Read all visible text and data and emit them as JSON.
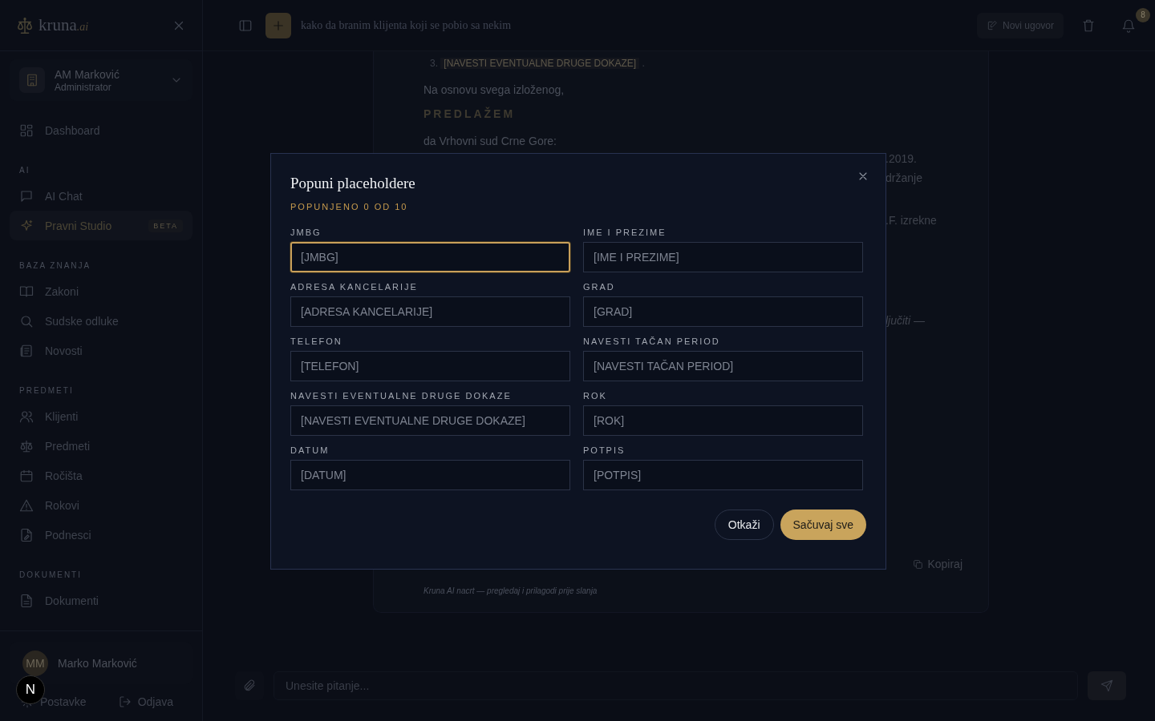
{
  "sidebar": {
    "logo": {
      "name": "kruna",
      "suffix": ".ai"
    },
    "organization": {
      "name": "AM Marković",
      "role": "Administrator"
    },
    "sections": [
      {
        "items": [
          {
            "label": "Dashboard",
            "selected": false
          }
        ]
      },
      {
        "title": "AI",
        "items": [
          {
            "label": "AI Chat",
            "selected": false
          },
          {
            "label": "Pravni Studio",
            "selected": true,
            "badge": "BETA"
          }
        ]
      },
      {
        "title": "BAZA ZNANJA",
        "items": [
          {
            "label": "Zakoni",
            "selected": false
          },
          {
            "label": "Sudske odluke",
            "selected": false
          },
          {
            "label": "Novosti",
            "selected": false
          }
        ]
      },
      {
        "title": "PREDMETI",
        "items": [
          {
            "label": "Klijenti",
            "selected": false
          },
          {
            "label": "Predmeti",
            "selected": false
          },
          {
            "label": "Ročišta",
            "selected": false
          },
          {
            "label": "Rokovi",
            "selected": false
          },
          {
            "label": "Podnesci",
            "selected": false
          }
        ]
      },
      {
        "title": "DOKUMENTI",
        "items": [
          {
            "label": "Dokumenti",
            "selected": false
          }
        ]
      }
    ],
    "user": {
      "initials": "MM",
      "name": "Marko Marković"
    },
    "footer_links": [
      {
        "label": "Postavke"
      },
      {
        "label": "Odjava"
      }
    ]
  },
  "dev_badge": "N",
  "header": {
    "chat_title": "kako da branim klijenta koji se pobio sa nekim",
    "new_contract": "Novi ugovor",
    "notifications": "8"
  },
  "document": {
    "list_item": {
      "number": "3.",
      "placeholder": "[NAVESTI EVENTUALNE DRUGE DOKAZE]",
      "end": "."
    },
    "paragraphs": [
      {
        "kind": "text",
        "text": "Na osnovu svega izloženog,"
      },
      {
        "kind": "heading",
        "text": "PREDLAŽEM"
      },
      {
        "kind": "text",
        "text": "da Vrhovni sud Crne Gore:"
      }
    ],
    "fragments": [
      {
        "kind": "text",
        "text": ".2019."
      },
      {
        "kind": "text",
        "text": "držanje"
      },
      {
        "kind": "text",
        "text": ".F. izrekne"
      },
      {
        "kind": "italic",
        "text": "ljučiti —"
      }
    ],
    "copy": "Kopiraj",
    "disclaimer": "Kruna AI nacrt — pregledaj i prilagodi prije slanja"
  },
  "composer": {
    "placeholder": "Unesite pitanje..."
  },
  "dialog": {
    "title": "Popuni placeholdere",
    "progress": "POPUNJENO 0 OD 10",
    "fields": [
      {
        "label": "JMBG",
        "placeholder": "[JMBG]",
        "focused": true
      },
      {
        "label": "IME I PREZIME",
        "placeholder": "[IME I PREZIME]",
        "focused": false
      },
      {
        "label": "ADRESA KANCELARIJE",
        "placeholder": "[ADRESA KANCELARIJE]",
        "focused": false
      },
      {
        "label": "GRAD",
        "placeholder": "[GRAD]",
        "focused": false
      },
      {
        "label": "TELEFON",
        "placeholder": "[TELEFON]",
        "focused": false
      },
      {
        "label": "NAVESTI TAČAN PERIOD",
        "placeholder": "[NAVESTI TAČAN PERIOD]",
        "focused": false
      },
      {
        "label": "NAVESTI EVENTUALNE DRUGE DOKAZE",
        "placeholder": "[NAVESTI EVENTUALNE DRUGE DOKAZE]",
        "focused": false
      },
      {
        "label": "ROK",
        "placeholder": "[ROK]",
        "focused": false
      },
      {
        "label": "DATUM",
        "placeholder": "[DATUM]",
        "focused": false
      },
      {
        "label": "POTPIS",
        "placeholder": "[POTPIS]",
        "focused": false
      }
    ],
    "cancel": "Otkaži",
    "save": "Sačuvaj sve"
  }
}
